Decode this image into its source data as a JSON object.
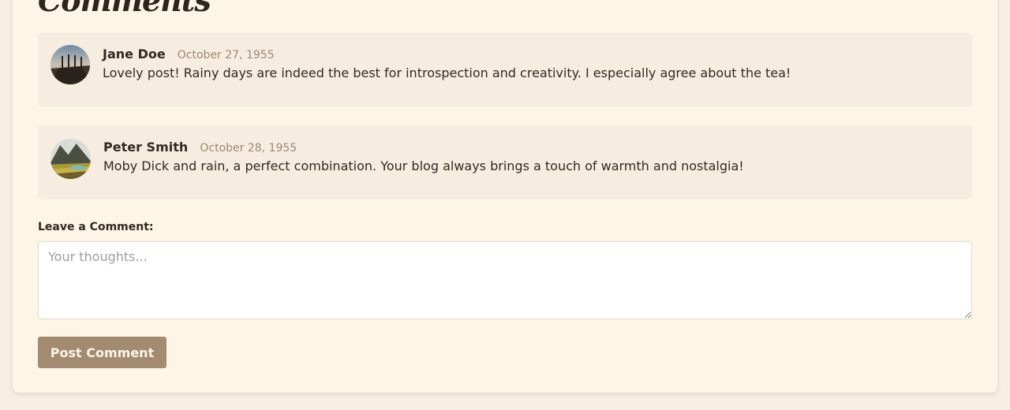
{
  "comments_section": {
    "title": "Comments"
  },
  "comments": [
    {
      "author": "Jane Doe",
      "date": "October 27, 1955",
      "text": "Lovely post! Rainy days are indeed the best for introspection and creativity. I especially agree about the tea!",
      "avatar": "pier-photo-avatar"
    },
    {
      "author": "Peter Smith",
      "date": "October 28, 1955",
      "text": "Moby Dick and rain, a perfect combination. Your blog always brings a touch of warmth and nostalgia!",
      "avatar": "mountain-lake-photo-avatar"
    }
  ],
  "form": {
    "label": "Leave a Comment:",
    "placeholder": "Your thoughts...",
    "value": "",
    "submit_label": "Post Comment"
  },
  "colors": {
    "page_background": "#f7efe2",
    "card_background": "#fdf5e6",
    "comment_background": "#f6ede0",
    "button_background": "#a38b72",
    "date_text": "#9b8a76"
  }
}
